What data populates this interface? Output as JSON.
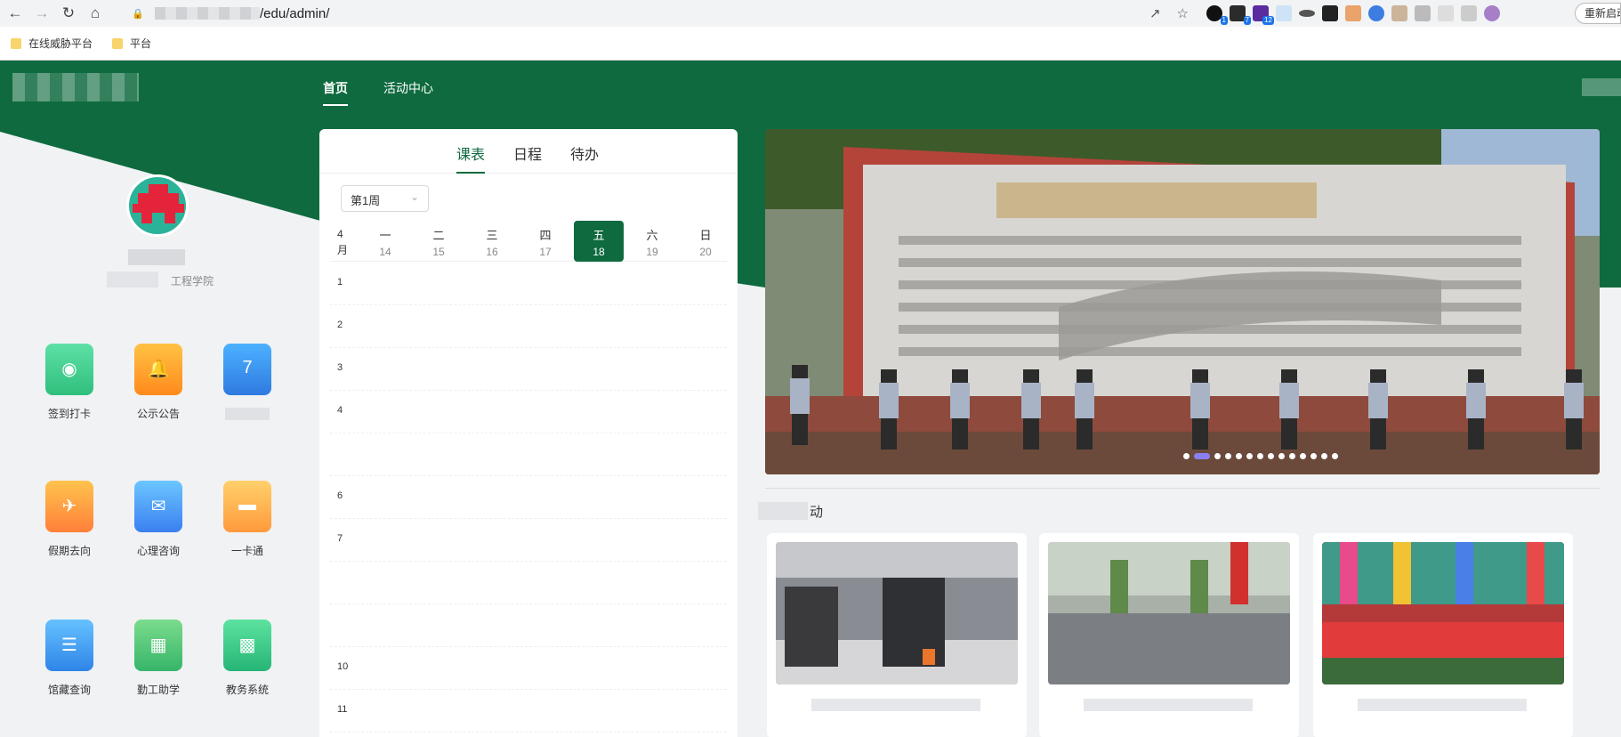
{
  "browser": {
    "url_suffix": "/edu/admin/",
    "restart_label": "重新启动",
    "bookmarks": [
      {
        "label": "在线威胁平台"
      },
      {
        "label": "平台"
      }
    ],
    "extensions": [
      {
        "icon": "chrome-ext-icon",
        "badge": "1"
      },
      {
        "icon": "chrome-ext-icon",
        "badge": "7"
      },
      {
        "icon": "grad-cap-icon",
        "badge": "12"
      }
    ]
  },
  "nav": {
    "items": [
      {
        "label": "首页",
        "active": true
      },
      {
        "label": "活动中心",
        "active": false
      }
    ]
  },
  "profile": {
    "department": "工程学院"
  },
  "apps": [
    {
      "label": "签到打卡",
      "icon": "location-icon",
      "color": "#3fcf8e"
    },
    {
      "label": "公示公告",
      "icon": "bell-icon",
      "color": "#ff9f1c"
    },
    {
      "label": "",
      "icon": "calendar-icon",
      "color": "#3a8de6",
      "glyph": "7"
    },
    {
      "label": "假期去向",
      "icon": "plane-icon",
      "color": "#ff9b32"
    },
    {
      "label": "心理咨询",
      "icon": "chat-icon",
      "color": "#4e9cf3"
    },
    {
      "label": "一卡通",
      "icon": "card-icon",
      "color": "#ffb74d"
    },
    {
      "label": "馆藏查询",
      "icon": "book-icon",
      "color": "#4aa3f0"
    },
    {
      "label": "勤工助学",
      "icon": "briefcase-icon",
      "color": "#48c774"
    },
    {
      "label": "教务系统",
      "icon": "monitor-icon",
      "color": "#2ec27e"
    }
  ],
  "schedule": {
    "tabs": [
      {
        "label": "课表",
        "active": true
      },
      {
        "label": "日程",
        "active": false
      },
      {
        "label": "待办",
        "active": false
      }
    ],
    "week": "第1周",
    "month_num": "4",
    "month_unit": "月",
    "days": [
      {
        "name": "一",
        "date": "14",
        "today": false
      },
      {
        "name": "二",
        "date": "15",
        "today": false
      },
      {
        "name": "三",
        "date": "16",
        "today": false
      },
      {
        "name": "四",
        "date": "17",
        "today": false
      },
      {
        "name": "五",
        "date": "18",
        "today": true
      },
      {
        "name": "六",
        "date": "19",
        "today": false
      },
      {
        "name": "日",
        "date": "20",
        "today": false
      }
    ],
    "periods": [
      "1",
      "2",
      "3",
      "4",
      "",
      "6",
      "7",
      "",
      "",
      "10",
      "11"
    ]
  },
  "activity": {
    "title_suffix": "动",
    "banner_slides": 14,
    "banner_active_slide": 2
  },
  "colors": {
    "brand_green": "#0f6b3f",
    "accent_purple": "#8a7ff0"
  }
}
